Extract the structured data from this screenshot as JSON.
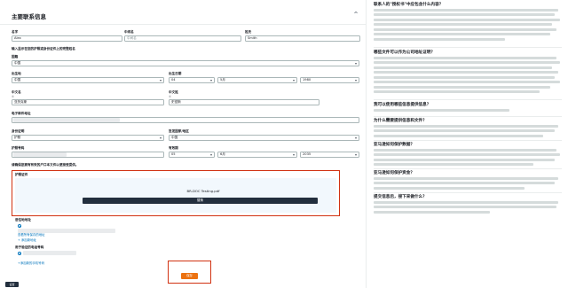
{
  "form": {
    "title": "主要联系信息",
    "first_name": {
      "label": "名字",
      "value": "Alex"
    },
    "middle_name": {
      "label": "中间名",
      "placeholder": "中间名"
    },
    "last_name": {
      "label": "姓氏",
      "value": "Smith"
    },
    "passport_name_heading": "输入显示在您的护照或身份证件上的完整姓名",
    "nationality": {
      "label": "国籍",
      "value": "中国"
    },
    "birthplace": {
      "label": "出生地",
      "value": "中国"
    },
    "birthdate": {
      "label": "出生日期",
      "day": "04",
      "month": "5月",
      "year": "1980"
    },
    "cn_last_name": {
      "label": "中文名",
      "sublabel": "①",
      "value": "亚历克斯"
    },
    "cn_first_name": {
      "label": "中文姓",
      "sublabel": "①",
      "value": "史密斯"
    },
    "email": {
      "label": "电子邮件地址"
    },
    "id_type": {
      "label": "身份证明",
      "value": "护照"
    },
    "issuing_country": {
      "label": "签发国家/地区",
      "value": "中国"
    },
    "passport_no": {
      "label": "护照号码"
    },
    "expiry": {
      "label": "有效期",
      "day": "05",
      "month": "6月",
      "year": "2035"
    },
    "upload_hint": "请确保您拥有有效的户口本文件以便接受提供。",
    "upload": {
      "label": "护照证件",
      "filename": "BR-DOC Testing.pdf",
      "replace_button": "替换"
    },
    "address": {
      "label": "居住地地址",
      "link_view": "查看所有保存的地址",
      "link_add": "+ 添加新地址"
    },
    "phone": {
      "label": "用于验证的电话号码",
      "link_add": "+添加新的手机号码"
    },
    "save_button": "保存",
    "lang_pill": "设置"
  },
  "faq": {
    "items": [
      {
        "q": "联系人的\"授权书\"中应包含什么内容？",
        "lines": 7
      },
      {
        "q": "哪些文件可以作为公司地址证明？",
        "lines": 8
      },
      {
        "q": "我可以使用哪些信息提供信息？",
        "lines": 1
      },
      {
        "q": "为什么需要提供信息和文件？",
        "lines": 3
      },
      {
        "q": "亚马逊如何保护数据？",
        "lines": 4
      },
      {
        "q": "亚马逊如何保护资金？",
        "lines": 3
      },
      {
        "q": "提交信息后，接下来做什么？",
        "lines": 3
      }
    ]
  },
  "colors": {
    "accent": "#0073bb",
    "save": "#ec7211",
    "highlight": "#d13212",
    "dark": "#232f3e"
  }
}
